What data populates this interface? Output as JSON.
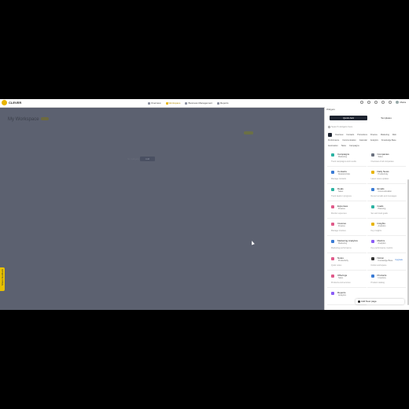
{
  "app": {
    "logo_text": "CLEVER",
    "nav": [
      {
        "label": "Overview",
        "active": false
      },
      {
        "label": "Workspace",
        "active": true
      },
      {
        "label": "Business Management",
        "active": false
      },
      {
        "label": "Reports",
        "active": false
      }
    ],
    "user": "Maria"
  },
  "workspace": {
    "title": "My Workspace",
    "empty_text": "No widgets",
    "add_button": "Add"
  },
  "feedback_label": "Share feedback",
  "panel": {
    "header": "Widgets",
    "tabs": [
      {
        "label": "Quick Add",
        "active": true
      },
      {
        "label": "Templates",
        "active": false
      }
    ],
    "search_placeholder": "Search widgets here",
    "categories": [
      {
        "label": "",
        "active": true
      },
      {
        "label": "Overview"
      },
      {
        "label": "Contacts"
      },
      {
        "label": "Promotions"
      },
      {
        "label": "Finance"
      },
      {
        "label": "Marketing"
      },
      {
        "label": "Web"
      },
      {
        "label": "Performance"
      },
      {
        "label": "Communication"
      },
      {
        "label": "Calendar"
      },
      {
        "label": "Analytics"
      },
      {
        "label": "Knowledge Base"
      },
      {
        "label": "Automation"
      },
      {
        "label": "Tasks"
      },
      {
        "label": "Campaigns"
      }
    ],
    "widgets": [
      {
        "name": "Campaigns",
        "tag": "Marketing",
        "desc": "Track campaigns and results",
        "color": "#2bb3a3"
      },
      {
        "name": "Companies",
        "tag": "Sales",
        "desc": "Overview of all companies",
        "color": "#6b7280"
      },
      {
        "name": "Contacts",
        "tag": "Relationships",
        "desc": "Manage contacts",
        "color": "#3a7bd5"
      },
      {
        "name": "Daily News",
        "tag": "Productivity",
        "desc": "Latest news updates",
        "color": "#e8b400"
      },
      {
        "name": "Deals",
        "tag": "Sales",
        "desc": "Track deals in progress",
        "color": "#2bb3a3"
      },
      {
        "name": "Emails",
        "tag": "Communication",
        "desc": "Recent emails and messages",
        "color": "#3a7bd5"
      },
      {
        "name": "Expenses",
        "tag": "Finance",
        "desc": "Monitor expenses",
        "color": "#e05a8a"
      },
      {
        "name": "Goals",
        "tag": "Planning",
        "desc": "Set and track goals",
        "color": "#2bb3a3"
      },
      {
        "name": "Invoices",
        "tag": "Finance",
        "desc": "Manage invoices",
        "color": "#e05a8a"
      },
      {
        "name": "Insights",
        "tag": "Analytics",
        "desc": "Key insights",
        "color": "#e8b400"
      },
      {
        "name": "Marketing Analytics",
        "tag": "Marketing",
        "desc": "Marketing performance",
        "color": "#3a7bd5"
      },
      {
        "name": "Metrics",
        "tag": "Analytics",
        "desc": "Key performance metrics",
        "color": "#8b5cf6"
      },
      {
        "name": "Notes",
        "tag": "Productivity",
        "desc": "Quick notes",
        "color": "#e05a8a"
      },
      {
        "name": "Notion",
        "tag": "Knowledge Base",
        "desc": "Notion workspace",
        "color": "#333333",
        "badge": "Upgrade"
      },
      {
        "name": "Offerings",
        "tag": "Sales",
        "desc": "Products and services",
        "color": "#e05a8a"
      },
      {
        "name": "Products",
        "tag": "Inventory",
        "desc": "Product catalog",
        "color": "#3a7bd5"
      },
      {
        "name": "Reports",
        "tag": "Analytics",
        "desc": "",
        "color": "#8b5cf6"
      }
    ],
    "add_page_button": "Add New page"
  }
}
